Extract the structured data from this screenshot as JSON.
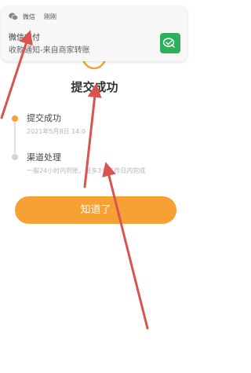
{
  "notification": {
    "app_icon": "wechat-icon",
    "app_name": "微信",
    "time": "刚刚",
    "title": "微信支付",
    "body": "收款通知-来自商家转账",
    "thumb_icon": "wechat-pay-icon"
  },
  "result": {
    "icon": "success-check-icon",
    "title": "提交成功"
  },
  "timeline": [
    {
      "label": "提交成功",
      "sub": "2021年5月8日 14:0",
      "status": "done"
    },
    {
      "label": "渠道处理",
      "sub": "一般24小时内到账，最多3个工作日内完成",
      "status": "pending"
    }
  ],
  "button": {
    "label": "知道了"
  },
  "colors": {
    "accent": "#f7a033",
    "wechat_green": "#2cb05a",
    "annotation_red": "#d9534f"
  }
}
